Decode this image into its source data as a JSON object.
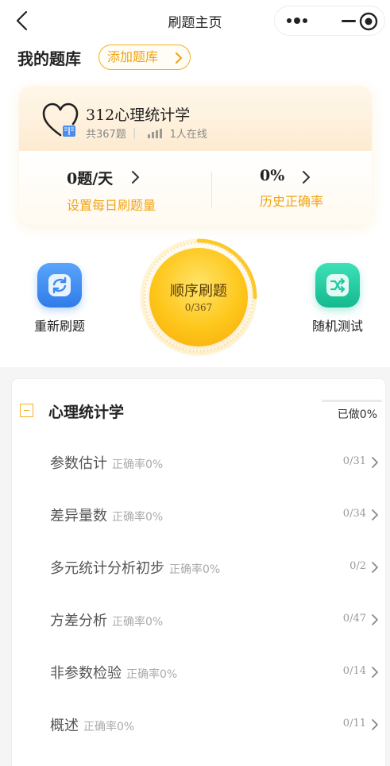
{
  "nav": {
    "title": "刷题主页"
  },
  "header": {
    "title": "我的题库",
    "add_label": "添加题库"
  },
  "bank": {
    "name": "312心理统计学",
    "total": "共367题",
    "online": "1人在线",
    "daily_value": "0题/天",
    "daily_label": "设置每日刷题量",
    "accuracy_value": "0%",
    "accuracy_label": "历史正确率"
  },
  "actions": {
    "restart_label": "重新刷题",
    "sequential_label": "顺序刷题",
    "sequential_progress": "0/367",
    "random_label": "随机测试"
  },
  "chapter": {
    "title": "心理统计学",
    "done": "已做0%",
    "progress_fraction": 0,
    "sections": [
      {
        "name": "参数估计",
        "rate": "正确率0%",
        "count": "0/31"
      },
      {
        "name": "差异量数",
        "rate": "正确率0%",
        "count": "0/34"
      },
      {
        "name": "多元统计分析初步",
        "rate": "正确率0%",
        "count": "0/2"
      },
      {
        "name": "方差分析",
        "rate": "正确率0%",
        "count": "0/47"
      },
      {
        "name": "非参数检验",
        "rate": "正确率0%",
        "count": "0/14"
      },
      {
        "name": "概述",
        "rate": "正确率0%",
        "count": "0/11"
      }
    ]
  },
  "colors": {
    "accent": "#f3a414",
    "restart_icon": "#3b8cf2",
    "random_icon": "#1fc9a0"
  }
}
